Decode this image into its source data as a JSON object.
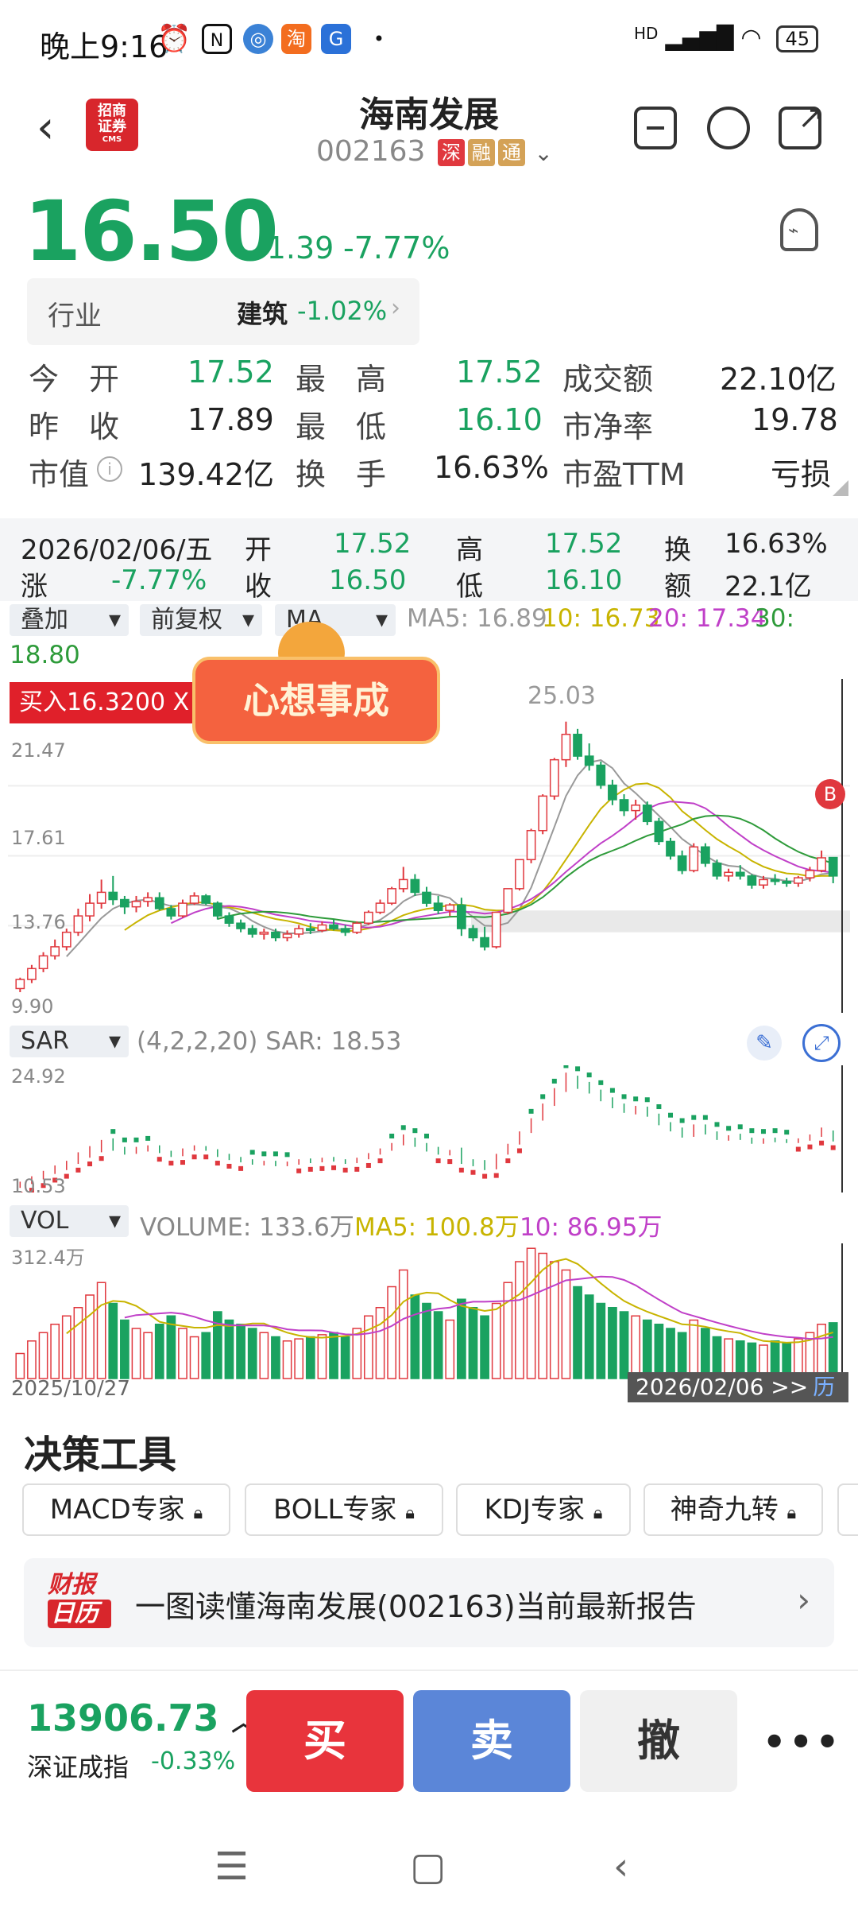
{
  "status": {
    "time": "晚上9:16",
    "battery": "45",
    "network": "HD"
  },
  "header": {
    "broker_logo": "招商证券",
    "broker_logo_sub": "CMS",
    "stock_name": "海南发展",
    "stock_code": "002163",
    "tags": [
      "深",
      "融",
      "通"
    ],
    "icons": [
      "minus-square-icon",
      "search-icon",
      "share-icon"
    ]
  },
  "quote": {
    "price": "16.50",
    "change": "-1.39",
    "change_pct": "-7.77%"
  },
  "industry": {
    "label": "行业",
    "name": "建筑",
    "pct": "-1.02%"
  },
  "stats": {
    "open_label": "今　开",
    "open": "17.52",
    "high_label": "最　高",
    "high": "17.52",
    "turnover_amt_label": "成交额",
    "turnover_amt": "22.10亿",
    "prev_close_label": "昨　收",
    "prev_close": "17.89",
    "low_label": "最　低",
    "low": "16.10",
    "pb_label": "市净率",
    "pb": "19.78",
    "mcap_label": "市值",
    "mcap": "139.42亿",
    "turnover_label": "换　手",
    "turnover": "16.63%",
    "pe_label": "市盈TTM",
    "pe": "亏损"
  },
  "day": {
    "date": "2026/02/06/五",
    "open_label": "开",
    "open": "17.52",
    "high_label": "高",
    "high": "17.52",
    "turn_label": "换",
    "turn": "16.63%",
    "chg_label": "涨",
    "chg": "-7.77%",
    "close_label": "收",
    "close": "16.50",
    "low_label": "低",
    "low": "16.10",
    "amt_label": "额",
    "amt": "22.1亿"
  },
  "kline_toolbar": {
    "overlay": "叠加",
    "adjust": "前复权",
    "indicator": "MA",
    "ma5": "MA5: 16.89",
    "ma10": "10: 16.73",
    "ma20": "20: 17.34",
    "ma30": "30:",
    "ma30_val": "18.80"
  },
  "kline": {
    "buy_marker": "买入16.3200 X",
    "banner": "心想事成",
    "high_label": "25.03",
    "y_labels": [
      "21.47",
      "17.61",
      "13.76",
      "9.90"
    ],
    "b_marker": "B"
  },
  "sar": {
    "name": "SAR",
    "params": "(4,2,2,20) SAR: 18.53",
    "top": "24.92",
    "bottom": "10.53"
  },
  "vol": {
    "name": "VOL",
    "volume": "VOLUME: 133.6万",
    "ma5": "MA5: 100.8万",
    "ma10": "10: 86.95万",
    "max": "312.4万",
    "start_date": "2025/10/27",
    "end_date": "2026/02/06 >>",
    "history": "历"
  },
  "tools": {
    "title": "决策工具",
    "items": [
      "MACD专家",
      "BOLL专家",
      "KDJ专家",
      "神奇九转"
    ]
  },
  "report": {
    "cal_top": "财报",
    "cal_bottom": "日历",
    "text": "一图读懂海南发展(002163)当前最新报告"
  },
  "bottom": {
    "index_value": "13906.73",
    "index_name": "深证成指",
    "index_pct": "-0.33%",
    "buy": "买",
    "sell": "卖",
    "cancel": "撤"
  },
  "colors": {
    "up": "#e0383e",
    "down": "#1aa260",
    "buy": "#e8343c",
    "sell": "#5b86d8"
  },
  "chart_data": {
    "type": "candlestick",
    "start_date": "2025/10/27",
    "end_date": "2026/02/06",
    "ylim": [
      9.9,
      25.03
    ],
    "candles": [
      [
        10.3,
        10.9,
        10.1,
        10.8
      ],
      [
        10.8,
        11.6,
        10.6,
        11.4
      ],
      [
        11.4,
        12.3,
        11.2,
        12.1
      ],
      [
        12.1,
        13.0,
        11.9,
        12.6
      ],
      [
        12.6,
        13.6,
        12.4,
        13.4
      ],
      [
        13.4,
        14.7,
        13.2,
        14.3
      ],
      [
        14.3,
        15.5,
        14.0,
        15.0
      ],
      [
        15.0,
        16.3,
        14.7,
        15.6
      ],
      [
        15.6,
        16.5,
        14.9,
        15.2
      ],
      [
        15.2,
        15.4,
        14.4,
        14.8
      ],
      [
        14.8,
        15.4,
        14.5,
        15.1
      ],
      [
        15.1,
        15.6,
        14.8,
        15.3
      ],
      [
        15.3,
        15.6,
        14.6,
        14.7
      ],
      [
        14.7,
        14.9,
        14.1,
        14.3
      ],
      [
        14.3,
        15.2,
        14.2,
        15.0
      ],
      [
        15.0,
        15.6,
        14.9,
        15.4
      ],
      [
        15.4,
        15.5,
        14.9,
        15.0
      ],
      [
        15.0,
        15.1,
        14.1,
        14.3
      ],
      [
        14.3,
        14.5,
        13.7,
        13.9
      ],
      [
        13.9,
        14.1,
        13.4,
        13.6
      ],
      [
        13.6,
        13.8,
        13.1,
        13.3
      ],
      [
        13.3,
        13.6,
        13.0,
        13.4
      ],
      [
        13.4,
        13.6,
        12.9,
        13.1
      ],
      [
        13.1,
        13.5,
        12.9,
        13.3
      ],
      [
        13.3,
        13.8,
        13.1,
        13.6
      ],
      [
        13.6,
        13.9,
        13.3,
        13.5
      ],
      [
        13.5,
        14.0,
        13.4,
        13.8
      ],
      [
        13.8,
        14.1,
        13.5,
        13.6
      ],
      [
        13.6,
        13.8,
        13.2,
        13.4
      ],
      [
        13.4,
        14.0,
        13.3,
        13.9
      ],
      [
        13.9,
        14.6,
        13.8,
        14.5
      ],
      [
        14.5,
        15.2,
        14.4,
        15.0
      ],
      [
        15.0,
        15.9,
        14.9,
        15.8
      ],
      [
        15.8,
        17.0,
        15.6,
        16.3
      ],
      [
        16.3,
        16.6,
        15.4,
        15.6
      ],
      [
        15.6,
        15.9,
        14.8,
        15.0
      ],
      [
        15.0,
        15.4,
        14.4,
        14.6
      ],
      [
        14.6,
        15.0,
        14.3,
        14.9
      ],
      [
        14.9,
        15.3,
        13.2,
        13.6
      ],
      [
        13.6,
        13.8,
        12.9,
        13.1
      ],
      [
        13.1,
        13.7,
        12.4,
        12.6
      ],
      [
        12.6,
        14.5,
        12.5,
        14.5
      ],
      [
        14.5,
        15.8,
        14.4,
        15.8
      ],
      [
        15.8,
        17.4,
        15.7,
        17.4
      ],
      [
        17.4,
        19.1,
        17.2,
        19.0
      ],
      [
        19.0,
        21.0,
        18.8,
        20.9
      ],
      [
        20.9,
        23.0,
        20.7,
        22.9
      ],
      [
        22.9,
        25.0,
        22.5,
        24.3
      ],
      [
        24.3,
        24.6,
        22.9,
        23.1
      ],
      [
        23.1,
        23.8,
        22.3,
        22.6
      ],
      [
        22.6,
        22.8,
        21.3,
        21.5
      ],
      [
        21.5,
        21.8,
        20.4,
        20.7
      ],
      [
        20.7,
        21.0,
        19.8,
        20.1
      ],
      [
        20.1,
        20.7,
        19.6,
        20.4
      ],
      [
        20.4,
        20.6,
        19.3,
        19.5
      ],
      [
        19.5,
        19.7,
        18.2,
        18.4
      ],
      [
        18.4,
        18.6,
        17.4,
        17.6
      ],
      [
        17.6,
        17.9,
        16.6,
        16.8
      ],
      [
        16.8,
        18.3,
        16.7,
        18.1
      ],
      [
        18.1,
        18.3,
        17.0,
        17.2
      ],
      [
        17.2,
        17.4,
        16.3,
        16.5
      ],
      [
        16.5,
        16.9,
        16.2,
        16.7
      ],
      [
        16.7,
        17.1,
        16.3,
        16.5
      ],
      [
        16.5,
        16.6,
        15.8,
        16.0
      ],
      [
        16.0,
        16.5,
        15.8,
        16.3
      ],
      [
        16.3,
        16.6,
        16.0,
        16.2
      ],
      [
        16.2,
        16.4,
        15.9,
        16.1
      ],
      [
        16.1,
        16.5,
        15.9,
        16.4
      ],
      [
        16.4,
        17.0,
        16.2,
        16.8
      ],
      [
        16.8,
        17.9,
        16.7,
        17.5
      ],
      [
        17.52,
        17.52,
        16.1,
        16.5
      ]
    ],
    "volumes": [
      60,
      90,
      110,
      130,
      150,
      170,
      200,
      230,
      180,
      140,
      120,
      110,
      130,
      150,
      120,
      100,
      110,
      160,
      140,
      130,
      120,
      110,
      100,
      90,
      95,
      100,
      105,
      110,
      100,
      120,
      150,
      170,
      220,
      260,
      200,
      180,
      160,
      140,
      190,
      170,
      150,
      180,
      230,
      280,
      312,
      300,
      280,
      260,
      220,
      200,
      180,
      170,
      160,
      150,
      140,
      130,
      120,
      110,
      140,
      120,
      100,
      95,
      90,
      85,
      80,
      90,
      85,
      95,
      110,
      130,
      133.6
    ]
  }
}
